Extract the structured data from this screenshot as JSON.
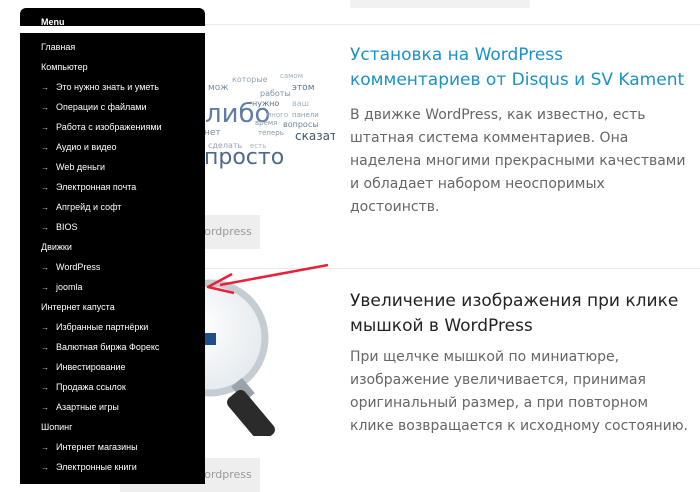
{
  "menu": {
    "title": "Menu",
    "items": [
      {
        "label": "Главная",
        "level": 0
      },
      {
        "label": "Компьютер",
        "level": 0
      },
      {
        "label": "Это нужно знать и уметь",
        "level": 1
      },
      {
        "label": "Операции с файлами",
        "level": 1
      },
      {
        "label": "Работа с изображениями",
        "level": 1
      },
      {
        "label": "Аудио и видео",
        "level": 1
      },
      {
        "label": "Web деньги",
        "level": 1
      },
      {
        "label": "Электронная почта",
        "level": 1
      },
      {
        "label": "Апгрейд и софт",
        "level": 1
      },
      {
        "label": "BIOS",
        "level": 1
      },
      {
        "label": "Движки",
        "level": 0
      },
      {
        "label": "WordPress",
        "level": 1
      },
      {
        "label": "joomla",
        "level": 1
      },
      {
        "label": "Интернет капуста",
        "level": 0
      },
      {
        "label": "Избранные партнёрки",
        "level": 1
      },
      {
        "label": "Валютная биржа Форекс",
        "level": 1
      },
      {
        "label": "Инвестирование",
        "level": 1
      },
      {
        "label": "Продажа ссылок",
        "level": 1
      },
      {
        "label": "Азартные игры",
        "level": 1
      },
      {
        "label": "Шопинг",
        "level": 0
      },
      {
        "label": "Интернет магазины",
        "level": 1
      },
      {
        "label": "Электронные книги",
        "level": 1
      }
    ],
    "sub_marker": "→"
  },
  "posts": [
    {
      "title_line1": "Установка на WordPress",
      "title_line2": "комментариев от Disqus и SV Kament",
      "excerpt": "В движке WordPress, как известно, есть штатная система комментариев.  Она наделена многими прекрасными качествами и обладает набором неоспоримых достоинств.",
      "more_label": "Wordpress",
      "title_color": "#1a91c9"
    },
    {
      "title_line1": "Увеличение изображения при клике",
      "title_line2": "мышкой в WordPress",
      "excerpt": "При щелчке мышкой по миниатюре,  изображение увеличивается, принимая оригинальный размер, а при повторном клике возвращается к исходному состоянию.",
      "more_label": "Wordpress",
      "title_color": "#222222"
    }
  ],
  "cloud_words": [
    "либо",
    "просто",
    "время",
    "сказать",
    "вопросы",
    "панели",
    "теперь",
    "нет",
    "сделать"
  ],
  "arrow_color": "#e8203a"
}
